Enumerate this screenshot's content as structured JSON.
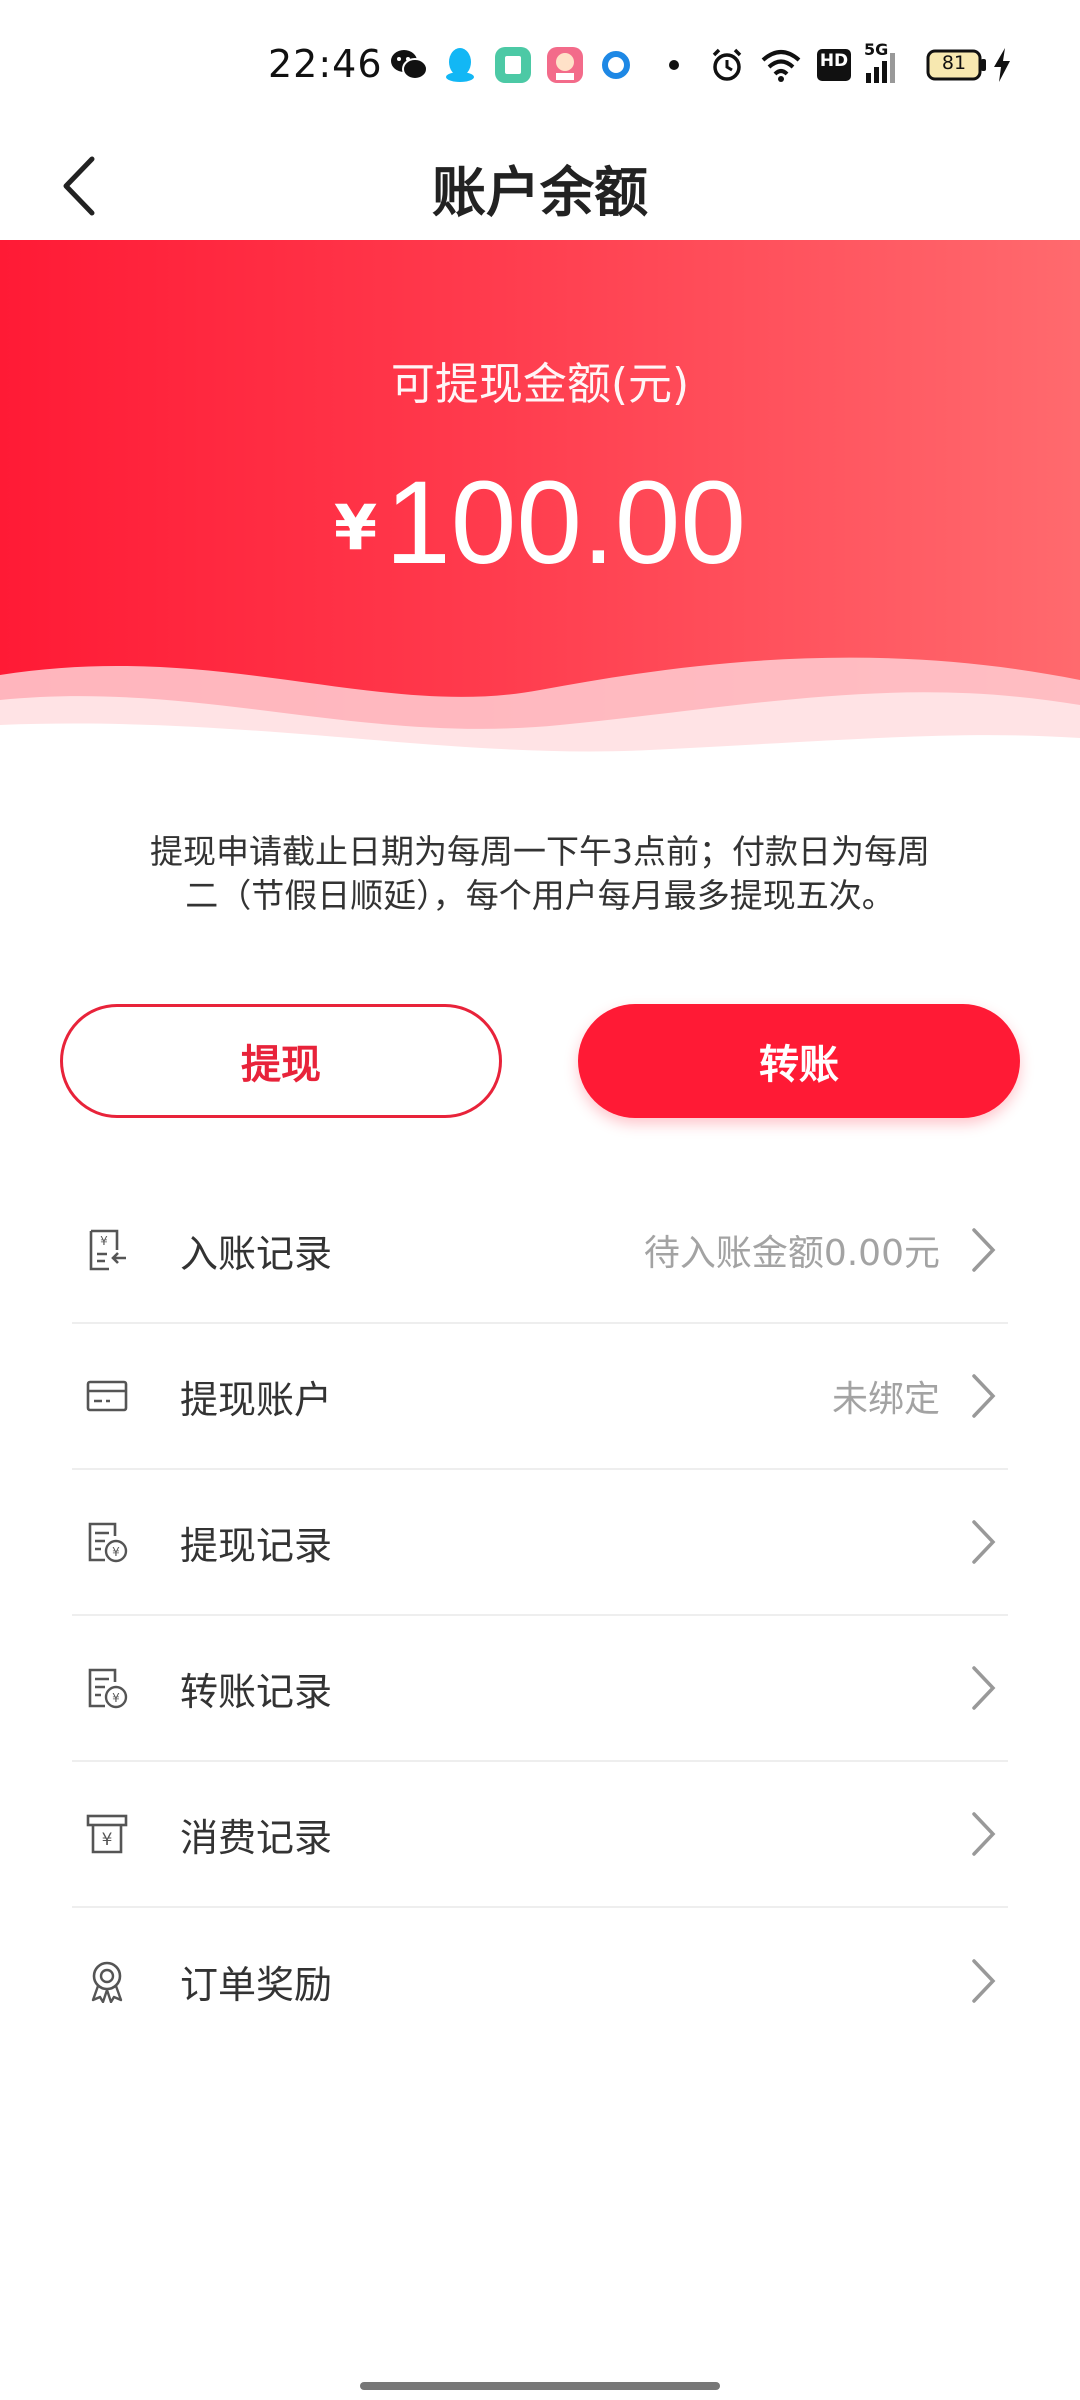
{
  "status_bar": {
    "time": "22:46",
    "network": "5G",
    "hd_label": "HD",
    "battery": "81",
    "icons": [
      "wechat-icon",
      "qq-icon",
      "app-green-icon",
      "app-avatar-icon",
      "app-blue-ring-icon",
      "dot-icon",
      "alarm-icon",
      "wifi-icon",
      "hd-icon",
      "signal-icon",
      "battery-icon",
      "charging-icon"
    ]
  },
  "header": {
    "title": "账户余额",
    "back_icon": "chevron-left-icon"
  },
  "hero": {
    "label": "可提现金额(元)",
    "currency": "¥",
    "amount": "100.00",
    "gradient": [
      "#ff1a35",
      "#ff6a6e"
    ]
  },
  "notice": {
    "line1": "提现申请截止日期为每周一下午3点前；付款日为每周",
    "line2": "二（节假日顺延），每个用户每月最多提现五次。"
  },
  "actions": {
    "withdraw_label": "提现",
    "transfer_label": "转账",
    "accent_color": "#ff1a35"
  },
  "menu": {
    "items": [
      {
        "label": "入账记录",
        "value": "待入账金额0.00元",
        "icon": "receipt-in-icon"
      },
      {
        "label": "提现账户",
        "value": "未绑定",
        "icon": "card-icon"
      },
      {
        "label": "提现记录",
        "value": "",
        "icon": "withdraw-record-icon"
      },
      {
        "label": "转账记录",
        "value": "",
        "icon": "transfer-record-icon"
      },
      {
        "label": "消费记录",
        "value": "",
        "icon": "consume-record-icon"
      },
      {
        "label": "订单奖励",
        "value": "",
        "icon": "award-icon"
      }
    ]
  }
}
